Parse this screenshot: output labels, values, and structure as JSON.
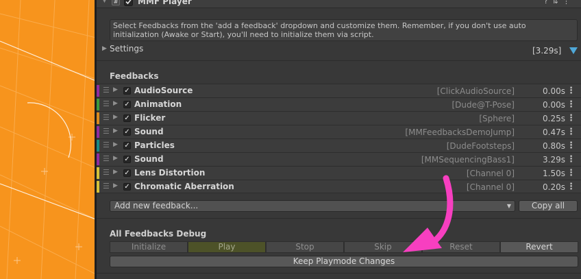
{
  "component": {
    "title": "MMF Player",
    "script_icon": "#",
    "help_text": "Select Feedbacks from the 'add a feedback' dropdown and customize them. Remember, if you don't use auto initialization (Awake or Start), you'll need to initialize them via script.",
    "settings_label": "Settings",
    "total_duration": "[3.29s]"
  },
  "feedbacks_section": {
    "title": "Feedbacks",
    "items": [
      {
        "name": "AudioSource",
        "target": "[ClickAudioSource]",
        "duration": "0.00s",
        "color": "#8e2ba0"
      },
      {
        "name": "Animation",
        "target": "[Dude@T-Pose]",
        "duration": "0.00s",
        "color": "#3c9a3c"
      },
      {
        "name": "Flicker",
        "target": "[Sphere]",
        "duration": "0.25s",
        "color": "#d98a1e"
      },
      {
        "name": "Sound",
        "target": "[MMFeedbacksDemoJump]",
        "duration": "0.47s",
        "color": "#8e2ba0"
      },
      {
        "name": "Particles",
        "target": "[DudeFootsteps]",
        "duration": "0.80s",
        "color": "#178a84"
      },
      {
        "name": "Sound",
        "target": "[MMSequencingBass1]",
        "duration": "3.29s",
        "color": "#8e2ba0"
      },
      {
        "name": "Lens Distortion",
        "target": "[Channel 0]",
        "duration": "1.50s",
        "color": "#d4c13a"
      },
      {
        "name": "Chromatic Aberration",
        "target": "[Channel 0]",
        "duration": "0.20s",
        "color": "#d4c13a"
      }
    ],
    "add_feedback_label": "Add new feedback...",
    "copy_all_label": "Copy all"
  },
  "debug_section": {
    "title": "All Feedbacks Debug",
    "buttons": [
      "Initialize",
      "Play",
      "Stop",
      "Skip",
      "Reset",
      "Revert"
    ],
    "keep_label": "Keep Playmode Changes"
  },
  "colors": {
    "scene_orange": "#f7941d",
    "arrow_pink": "#f73fc0",
    "accent_blue": "#4fa8d8"
  }
}
